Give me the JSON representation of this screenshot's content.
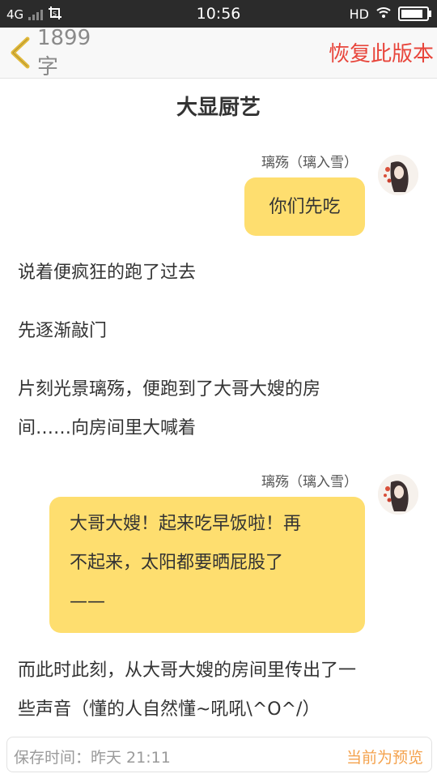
{
  "status_bar": {
    "network": "4G",
    "time": "10:56",
    "hd": "HD"
  },
  "header": {
    "word_count": "1899字",
    "restore_label": "恢复此版本"
  },
  "chapter_title": "大显厨艺",
  "messages": [
    {
      "speaker": "璃殇（璃入雪）",
      "text_lines": [
        "你们先吃"
      ]
    },
    {
      "speaker": "璃殇（璃入雪）",
      "text_lines": [
        "大哥大嫂！起来吃早饭啦！再",
        "不起来，太阳都要晒屁股了",
        "——"
      ]
    }
  ],
  "paragraphs": [
    "说着便疯狂的跑了过去",
    "先逐渐敲门",
    "片刻光景璃殇，便跑到了大哥大嫂的房",
    "间……向房间里大喊着",
    "而此时此刻，从大哥大嫂的房间里传出了一",
    "些声音（懂的人自然懂~吼吼\\^O^/）"
  ],
  "footer": {
    "save_time": "保存时间：昨天 21:11",
    "preview_label": "当前为预览"
  },
  "colors": {
    "bubble": "#fede6f",
    "accent_red": "#e8463c",
    "accent_orange": "#f4a24d",
    "back_arrow": "#e1b93b"
  }
}
